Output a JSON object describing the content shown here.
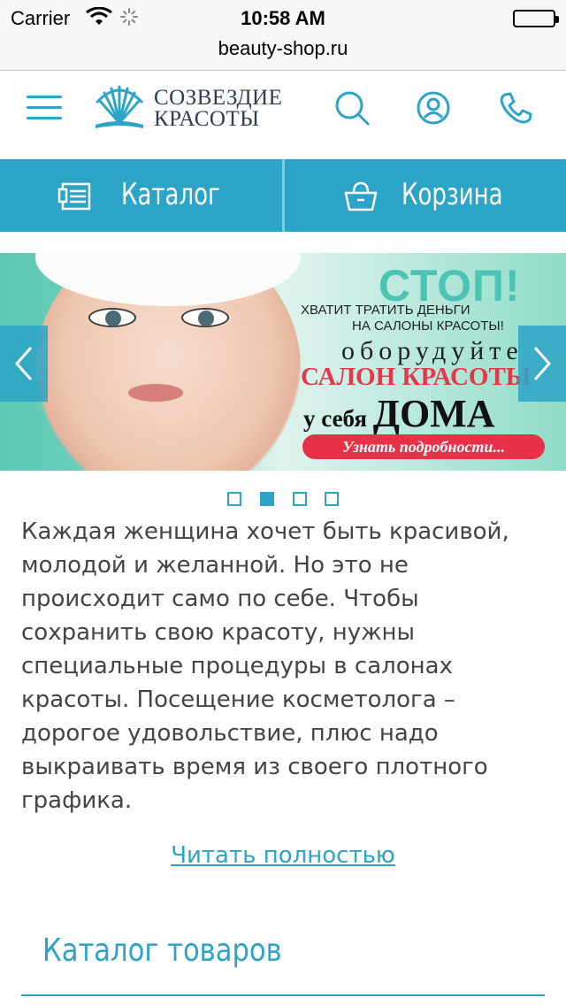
{
  "statusbar": {
    "carrier": "Carrier",
    "time": "10:58 AM"
  },
  "browser": {
    "url": "beauty-shop.ru"
  },
  "header": {
    "logo_line1": "СОЗВЕЗДИЕ",
    "logo_line2": "КРАСОТЫ",
    "menu_icon": "hamburger-icon",
    "search_icon": "search-icon",
    "account_icon": "user-icon",
    "phone_icon": "phone-icon",
    "accent_color": "#2ca4c7"
  },
  "nav": {
    "catalog_label": "Каталог",
    "cart_label": "Корзина"
  },
  "banner": {
    "headline": "СТОП!",
    "line1": "ХВАТИТ ТРАТИТЬ ДЕНЬГИ",
    "line2": "НА САЛОНЫ КРАСОТЫ!",
    "line3": "оборудуйте",
    "line4": "САЛОН КРАСОТЫ",
    "line5_prefix": "у себя",
    "line5_big": "ДОМА",
    "cta": "Узнать подробности...",
    "slides_count": 4,
    "active_slide": 2
  },
  "intro": {
    "text": "Каждая женщина хочет быть красивой, молодой и желанной. Но это не происходит само по себе. Чтобы сохранить свою красоту, нужны специальные процедуры в салонах красоты. Посещение косметолога – дорогое удовольствие, плюс надо выкраивать время из своего плотного графика.",
    "read_more": "Читать полностью"
  },
  "catalog_section": {
    "title": "Каталог товаров"
  }
}
